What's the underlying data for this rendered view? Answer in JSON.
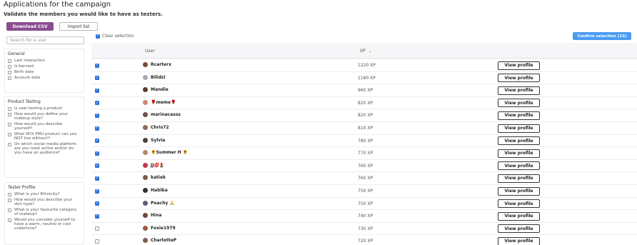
{
  "header": {
    "title": "Applications for the campaign",
    "subtitle": "Validate the members you would like to have as testers."
  },
  "toolbar": {
    "download_label": "Download CSV",
    "import_label": "Import list",
    "clear_selection_label": "Clear selection",
    "confirm_label": "Confirm selection (13)"
  },
  "search": {
    "placeholder": "Search for a user"
  },
  "filters": [
    {
      "title": "General",
      "options": [
        "Last interaction",
        "Is banned",
        "Birth date",
        "Account date"
      ]
    },
    {
      "title": "Product Testing",
      "options": [
        "Is user testing a product",
        "How would you define your makeup style?",
        "How would you describe yourself?",
        "What NYX PMU product can you NOT live without?!",
        "On which social media platform are you most active and/or do you have an audience?"
      ]
    },
    {
      "title": "Tester Profile",
      "options": [
        "What is your Ethnicity?",
        "How would you describe your skin type?",
        "What is your favourite category of makeup?",
        "Would you consider yourself to have a warm, neutral or cool undertone?"
      ]
    }
  ],
  "table": {
    "col_user": "User",
    "col_xp": "XP",
    "view_label": "View profile",
    "rows": [
      {
        "user": "Rcarterx",
        "xp": "1220 XP",
        "checked": true,
        "avatar": "#7a4b3a"
      },
      {
        "user": "Bilidzi",
        "xp": "1180 XP",
        "checked": true,
        "avatar": "#a8a8b4"
      },
      {
        "user": "Mandie",
        "xp": "960 XP",
        "checked": true,
        "avatar": "#5a3a2e"
      },
      {
        "user": "🌹meme🌹",
        "xp": "820 XP",
        "checked": true,
        "avatar": "#c98a6a"
      },
      {
        "user": "marinacasss",
        "xp": "820 XP",
        "checked": true,
        "avatar": "#6b5446"
      },
      {
        "user": "Chris72",
        "xp": "810 XP",
        "checked": true,
        "avatar": "#8a6a5a"
      },
      {
        "user": "Sylvia",
        "xp": "780 XP",
        "checked": true,
        "avatar": "#4a4038"
      },
      {
        "user": "🌻Summer H 🌻",
        "xp": "770 XP",
        "checked": true,
        "avatar": "#b08a6a"
      },
      {
        "user": "JJ💋💄",
        "xp": "760 XP",
        "checked": true,
        "avatar": "#c23a4a"
      },
      {
        "user": "katiek",
        "xp": "760 XP",
        "checked": true,
        "avatar": "#7a5a4a"
      },
      {
        "user": "Habiba",
        "xp": "750 XP",
        "checked": true,
        "avatar": "#3a2e2a"
      },
      {
        "user": "Peachy 🙏",
        "xp": "750 XP",
        "checked": true,
        "avatar": "#5a5a7a"
      },
      {
        "user": "Hina",
        "xp": "740 XP",
        "checked": true,
        "avatar": "#6a4a3a"
      },
      {
        "user": "Foxie1979",
        "xp": "730 XP",
        "checked": false,
        "avatar": "#9a5a3a"
      },
      {
        "user": "CharlotteP",
        "xp": "720 XP",
        "checked": false,
        "avatar": "#7a6050"
      }
    ]
  },
  "colors": {
    "primary_button": "#8a4d8f",
    "confirm_button": "#4a9cf0",
    "checkbox_checked": "#2e74d9"
  }
}
